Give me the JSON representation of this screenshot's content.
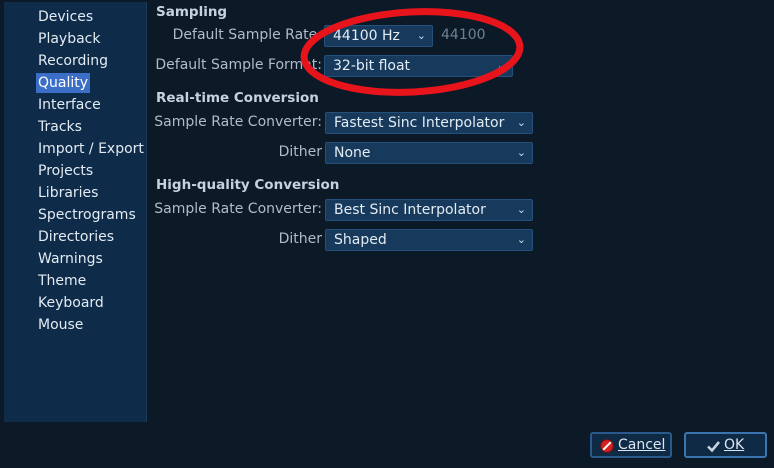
{
  "sidebar": {
    "items": [
      {
        "label": "Devices"
      },
      {
        "label": "Playback"
      },
      {
        "label": "Recording"
      },
      {
        "label": "Quality",
        "selected": true
      },
      {
        "label": "Interface"
      },
      {
        "label": "Tracks"
      },
      {
        "label": "Import / Export"
      },
      {
        "label": "Projects"
      },
      {
        "label": "Libraries"
      },
      {
        "label": "Spectrograms"
      },
      {
        "label": "Directories"
      },
      {
        "label": "Warnings"
      },
      {
        "label": "Theme"
      },
      {
        "label": "Keyboard"
      },
      {
        "label": "Mouse"
      }
    ]
  },
  "sampling": {
    "title": "Sampling",
    "rate_label": "Default Sample Rate:",
    "rate_value": "44100 Hz",
    "rate_text": "44100",
    "format_label": "Default Sample Format:",
    "format_value": "32-bit float"
  },
  "realtime": {
    "title": "Real-time Conversion",
    "converter_label": "Sample Rate Converter:",
    "converter_value": "Fastest Sinc Interpolator",
    "dither_label": "Dither",
    "dither_value": "None"
  },
  "highquality": {
    "title": "High-quality Conversion",
    "converter_label": "Sample Rate Converter:",
    "converter_value": "Best Sinc Interpolator",
    "dither_label": "Dither",
    "dither_value": "Shaped"
  },
  "buttons": {
    "cancel": "Cancel",
    "ok": "OK"
  },
  "annotation": {
    "color": "#e8141c"
  }
}
